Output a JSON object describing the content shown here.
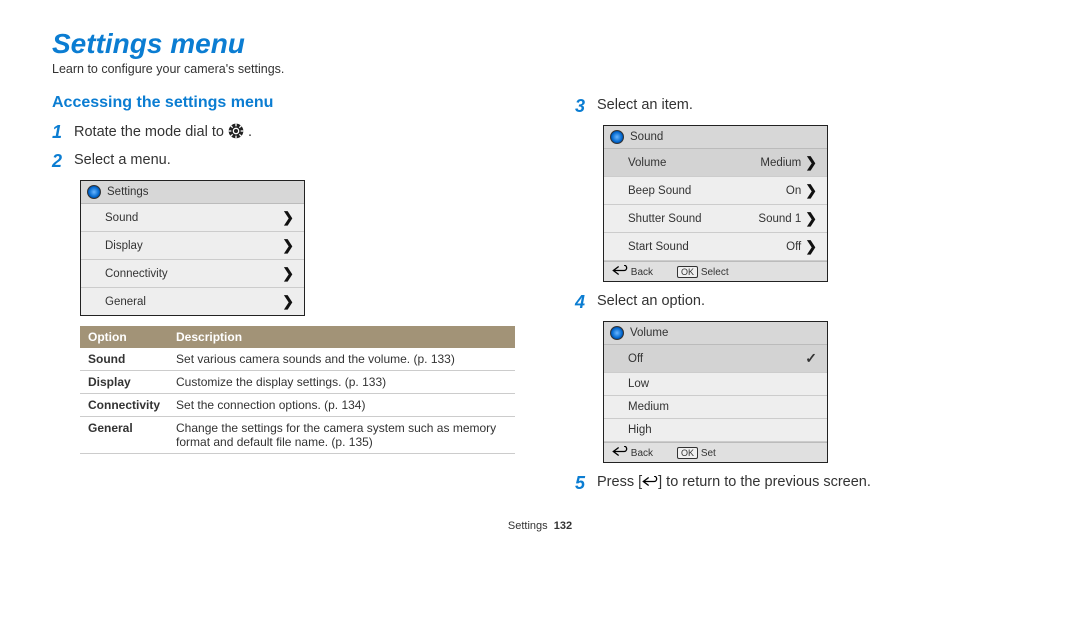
{
  "title": "Settings menu",
  "subtitle": "Learn to configure your camera's settings.",
  "left": {
    "heading": "Accessing the settings menu",
    "step1": {
      "num": "1",
      "text_before": "Rotate the mode dial to ",
      "text_after": "."
    },
    "step2": {
      "num": "2",
      "text": "Select a menu."
    },
    "menu_box": {
      "header": "Settings",
      "rows": [
        {
          "label": "Sound"
        },
        {
          "label": "Display"
        },
        {
          "label": "Connectivity"
        },
        {
          "label": "General"
        }
      ]
    },
    "desc_table": {
      "head_option": "Option",
      "head_desc": "Description",
      "rows": [
        {
          "opt": "Sound",
          "desc": "Set various camera sounds and the volume. (p. 133)"
        },
        {
          "opt": "Display",
          "desc": "Customize the display settings. (p. 133)"
        },
        {
          "opt": "Connectivity",
          "desc": "Set the connection options. (p. 134)"
        },
        {
          "opt": "General",
          "desc": "Change the settings for the camera system such as memory format and default file name. (p. 135)"
        }
      ]
    }
  },
  "right": {
    "step3": {
      "num": "3",
      "text": "Select an item."
    },
    "sound_box": {
      "header": "Sound",
      "rows": [
        {
          "label": "Volume",
          "value": "Medium",
          "highlight": true
        },
        {
          "label": "Beep Sound",
          "value": "On"
        },
        {
          "label": "Shutter Sound",
          "value": "Sound 1"
        },
        {
          "label": "Start Sound",
          "value": "Off"
        }
      ],
      "footer_back": "Back",
      "footer_ok": "OK",
      "footer_sel": "Select"
    },
    "step4": {
      "num": "4",
      "text": "Select an option."
    },
    "volume_box": {
      "header": "Volume",
      "rows": [
        {
          "label": "Off",
          "checked": true
        },
        {
          "label": "Low"
        },
        {
          "label": "Medium"
        },
        {
          "label": "High"
        }
      ],
      "footer_back": "Back",
      "footer_ok": "OK",
      "footer_set": "Set"
    },
    "step5": {
      "num": "5",
      "text_before": "Press [",
      "text_after": "] to return to the previous screen."
    }
  },
  "footer": {
    "label": "Settings",
    "page": "132"
  }
}
